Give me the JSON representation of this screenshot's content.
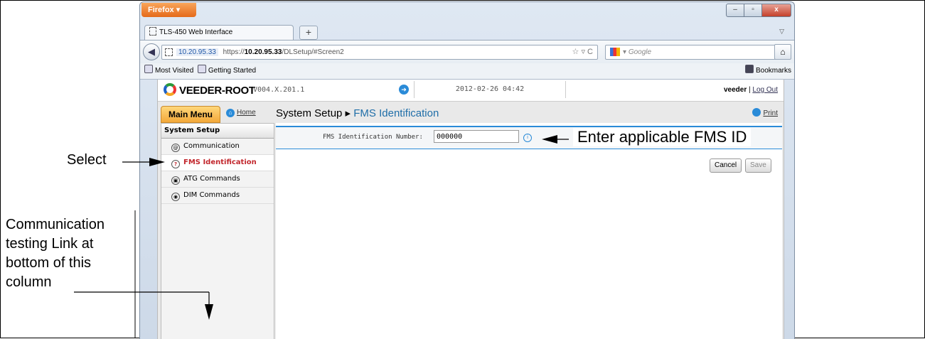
{
  "browser": {
    "menu_button": "Firefox",
    "tab_title": "TLS-450 Web Interface",
    "new_tab": "+",
    "url_ip": "10.20.95.33",
    "url_prefix": "https://",
    "url_host": "10.20.95.33",
    "url_path": "/DLSetup/#Screen2",
    "search_placeholder": "Google",
    "bookmarks": [
      "Most Visited",
      "Getting Started"
    ],
    "bookmarks_menu": "Bookmarks"
  },
  "app": {
    "logo": "VEEDER-ROOT",
    "version": "V004.X.201.1",
    "datetime": "2012-02-26 04:42",
    "username": "veeder",
    "logout": "Log Out",
    "main_menu": "Main Menu",
    "home": "Home",
    "breadcrumb_parent": "System Setup",
    "breadcrumb_current": "FMS Identification",
    "print": "Print"
  },
  "sidebar": {
    "title": "System Setup",
    "items": [
      {
        "label": "Communication",
        "selected": false
      },
      {
        "label": "FMS Identification",
        "selected": true
      },
      {
        "label": "ATG Commands",
        "selected": false
      },
      {
        "label": "DIM Commands",
        "selected": false
      }
    ]
  },
  "form": {
    "label": "FMS Identification Number:",
    "value": "000000",
    "cancel": "Cancel",
    "save": "Save"
  },
  "annotations": {
    "select": "Select",
    "fms": "Enter applicable FMS ID",
    "comm_lines": [
      "Communication",
      "testing Link at",
      "bottom of this",
      "column"
    ]
  },
  "colors": {
    "accent": "#2a8bd8",
    "selected_text": "#c2272d",
    "breadcrumb": "#1f6ea8"
  }
}
